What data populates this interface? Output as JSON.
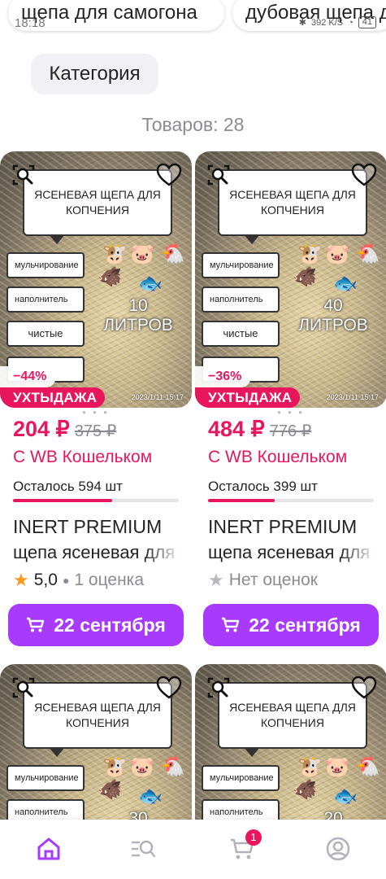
{
  "status_bar": {
    "time": "18:18",
    "battery": "41",
    "net": "392 K/S"
  },
  "search_chips": [
    "щепа для самогона",
    "дубовая щепа для"
  ],
  "filter": {
    "category_label": "Категория"
  },
  "results": {
    "count_label": "Товаров: 28"
  },
  "products": [
    {
      "image": {
        "title": "ЯСЕНЕВАЯ ЩЕПА ДЛЯ КОПЧЕНИЯ",
        "tags": [
          "мульчирование",
          "наполнитель",
          "чистые"
        ],
        "volume": "10 ЛИТРОВ",
        "stamp": "2023/1/11 15:17"
      },
      "discount": "−44%",
      "promo": "УХТЫДАЖА",
      "price": "204 ₽",
      "old_price": "375 ₽",
      "wallet": "С WB Кошельком",
      "stock": "Осталось 594 шт",
      "stock_fill": 0.6,
      "brand": "INERT PREMIUM",
      "name": "щепа ясеневая для копчения",
      "rating": {
        "value": "5,0",
        "count": "1 оценка",
        "has_rating": true
      },
      "delivery": "22 сентября"
    },
    {
      "image": {
        "title": "ЯСЕНЕВАЯ ЩЕПА ДЛЯ КОПЧЕНИЯ",
        "tags": [
          "мульчирование",
          "наполнитель",
          "чистые"
        ],
        "volume": "40 ЛИТРОВ",
        "stamp": "2023/1/11 15:17"
      },
      "discount": "−36%",
      "promo": "УХТЫДАЖА",
      "price": "484 ₽",
      "old_price": "776 ₽",
      "wallet": "С WB Кошельком",
      "stock": "Осталось 399 шт",
      "stock_fill": 0.4,
      "brand": "INERT PREMIUM",
      "name": "щепа ясеневая для копчения",
      "rating": {
        "value": "",
        "count": "Нет оценок",
        "has_rating": false
      },
      "delivery": "22 сентября"
    },
    {
      "image": {
        "title": "ЯСЕНЕВАЯ ЩЕПА ДЛЯ КОПЧЕНИЯ",
        "tags": [
          "мульчирование",
          "наполнитель"
        ],
        "volume": "30",
        "stamp": ""
      }
    },
    {
      "image": {
        "title": "ЯСЕНЕВАЯ ЩЕПА ДЛЯ КОПЧЕНИЯ",
        "tags": [
          "мульчирование",
          "наполнитель"
        ],
        "volume": "20",
        "stamp": ""
      }
    }
  ],
  "navbar": {
    "items": [
      "home-icon",
      "catalog-icon",
      "cart-icon",
      "profile-icon"
    ],
    "cart_badge": "1",
    "active_color": "#a73afd"
  },
  "colors": {
    "accent": "#a73afd",
    "sale": "#e8175d",
    "star": "#ff9a1e"
  }
}
